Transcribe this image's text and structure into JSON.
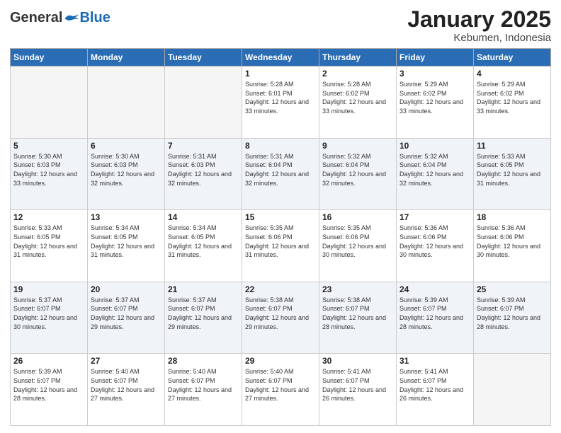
{
  "header": {
    "logo_general": "General",
    "logo_blue": "Blue",
    "title": "January 2025",
    "subtitle": "Kebumen, Indonesia"
  },
  "calendar": {
    "weekdays": [
      "Sunday",
      "Monday",
      "Tuesday",
      "Wednesday",
      "Thursday",
      "Friday",
      "Saturday"
    ],
    "rows": [
      [
        {
          "day": "",
          "sunrise": "",
          "sunset": "",
          "daylight": ""
        },
        {
          "day": "",
          "sunrise": "",
          "sunset": "",
          "daylight": ""
        },
        {
          "day": "",
          "sunrise": "",
          "sunset": "",
          "daylight": ""
        },
        {
          "day": "1",
          "sunrise": "Sunrise: 5:28 AM",
          "sunset": "Sunset: 6:01 PM",
          "daylight": "Daylight: 12 hours and 33 minutes."
        },
        {
          "day": "2",
          "sunrise": "Sunrise: 5:28 AM",
          "sunset": "Sunset: 6:02 PM",
          "daylight": "Daylight: 12 hours and 33 minutes."
        },
        {
          "day": "3",
          "sunrise": "Sunrise: 5:29 AM",
          "sunset": "Sunset: 6:02 PM",
          "daylight": "Daylight: 12 hours and 33 minutes."
        },
        {
          "day": "4",
          "sunrise": "Sunrise: 5:29 AM",
          "sunset": "Sunset: 6:02 PM",
          "daylight": "Daylight: 12 hours and 33 minutes."
        }
      ],
      [
        {
          "day": "5",
          "sunrise": "Sunrise: 5:30 AM",
          "sunset": "Sunset: 6:03 PM",
          "daylight": "Daylight: 12 hours and 33 minutes."
        },
        {
          "day": "6",
          "sunrise": "Sunrise: 5:30 AM",
          "sunset": "Sunset: 6:03 PM",
          "daylight": "Daylight: 12 hours and 32 minutes."
        },
        {
          "day": "7",
          "sunrise": "Sunrise: 5:31 AM",
          "sunset": "Sunset: 6:03 PM",
          "daylight": "Daylight: 12 hours and 32 minutes."
        },
        {
          "day": "8",
          "sunrise": "Sunrise: 5:31 AM",
          "sunset": "Sunset: 6:04 PM",
          "daylight": "Daylight: 12 hours and 32 minutes."
        },
        {
          "day": "9",
          "sunrise": "Sunrise: 5:32 AM",
          "sunset": "Sunset: 6:04 PM",
          "daylight": "Daylight: 12 hours and 32 minutes."
        },
        {
          "day": "10",
          "sunrise": "Sunrise: 5:32 AM",
          "sunset": "Sunset: 6:04 PM",
          "daylight": "Daylight: 12 hours and 32 minutes."
        },
        {
          "day": "11",
          "sunrise": "Sunrise: 5:33 AM",
          "sunset": "Sunset: 6:05 PM",
          "daylight": "Daylight: 12 hours and 31 minutes."
        }
      ],
      [
        {
          "day": "12",
          "sunrise": "Sunrise: 5:33 AM",
          "sunset": "Sunset: 6:05 PM",
          "daylight": "Daylight: 12 hours and 31 minutes."
        },
        {
          "day": "13",
          "sunrise": "Sunrise: 5:34 AM",
          "sunset": "Sunset: 6:05 PM",
          "daylight": "Daylight: 12 hours and 31 minutes."
        },
        {
          "day": "14",
          "sunrise": "Sunrise: 5:34 AM",
          "sunset": "Sunset: 6:05 PM",
          "daylight": "Daylight: 12 hours and 31 minutes."
        },
        {
          "day": "15",
          "sunrise": "Sunrise: 5:35 AM",
          "sunset": "Sunset: 6:06 PM",
          "daylight": "Daylight: 12 hours and 31 minutes."
        },
        {
          "day": "16",
          "sunrise": "Sunrise: 5:35 AM",
          "sunset": "Sunset: 6:06 PM",
          "daylight": "Daylight: 12 hours and 30 minutes."
        },
        {
          "day": "17",
          "sunrise": "Sunrise: 5:36 AM",
          "sunset": "Sunset: 6:06 PM",
          "daylight": "Daylight: 12 hours and 30 minutes."
        },
        {
          "day": "18",
          "sunrise": "Sunrise: 5:36 AM",
          "sunset": "Sunset: 6:06 PM",
          "daylight": "Daylight: 12 hours and 30 minutes."
        }
      ],
      [
        {
          "day": "19",
          "sunrise": "Sunrise: 5:37 AM",
          "sunset": "Sunset: 6:07 PM",
          "daylight": "Daylight: 12 hours and 30 minutes."
        },
        {
          "day": "20",
          "sunrise": "Sunrise: 5:37 AM",
          "sunset": "Sunset: 6:07 PM",
          "daylight": "Daylight: 12 hours and 29 minutes."
        },
        {
          "day": "21",
          "sunrise": "Sunrise: 5:37 AM",
          "sunset": "Sunset: 6:07 PM",
          "daylight": "Daylight: 12 hours and 29 minutes."
        },
        {
          "day": "22",
          "sunrise": "Sunrise: 5:38 AM",
          "sunset": "Sunset: 6:07 PM",
          "daylight": "Daylight: 12 hours and 29 minutes."
        },
        {
          "day": "23",
          "sunrise": "Sunrise: 5:38 AM",
          "sunset": "Sunset: 6:07 PM",
          "daylight": "Daylight: 12 hours and 28 minutes."
        },
        {
          "day": "24",
          "sunrise": "Sunrise: 5:39 AM",
          "sunset": "Sunset: 6:07 PM",
          "daylight": "Daylight: 12 hours and 28 minutes."
        },
        {
          "day": "25",
          "sunrise": "Sunrise: 5:39 AM",
          "sunset": "Sunset: 6:07 PM",
          "daylight": "Daylight: 12 hours and 28 minutes."
        }
      ],
      [
        {
          "day": "26",
          "sunrise": "Sunrise: 5:39 AM",
          "sunset": "Sunset: 6:07 PM",
          "daylight": "Daylight: 12 hours and 28 minutes."
        },
        {
          "day": "27",
          "sunrise": "Sunrise: 5:40 AM",
          "sunset": "Sunset: 6:07 PM",
          "daylight": "Daylight: 12 hours and 27 minutes."
        },
        {
          "day": "28",
          "sunrise": "Sunrise: 5:40 AM",
          "sunset": "Sunset: 6:07 PM",
          "daylight": "Daylight: 12 hours and 27 minutes."
        },
        {
          "day": "29",
          "sunrise": "Sunrise: 5:40 AM",
          "sunset": "Sunset: 6:07 PM",
          "daylight": "Daylight: 12 hours and 27 minutes."
        },
        {
          "day": "30",
          "sunrise": "Sunrise: 5:41 AM",
          "sunset": "Sunset: 6:07 PM",
          "daylight": "Daylight: 12 hours and 26 minutes."
        },
        {
          "day": "31",
          "sunrise": "Sunrise: 5:41 AM",
          "sunset": "Sunset: 6:07 PM",
          "daylight": "Daylight: 12 hours and 26 minutes."
        },
        {
          "day": "",
          "sunrise": "",
          "sunset": "",
          "daylight": ""
        }
      ]
    ]
  }
}
